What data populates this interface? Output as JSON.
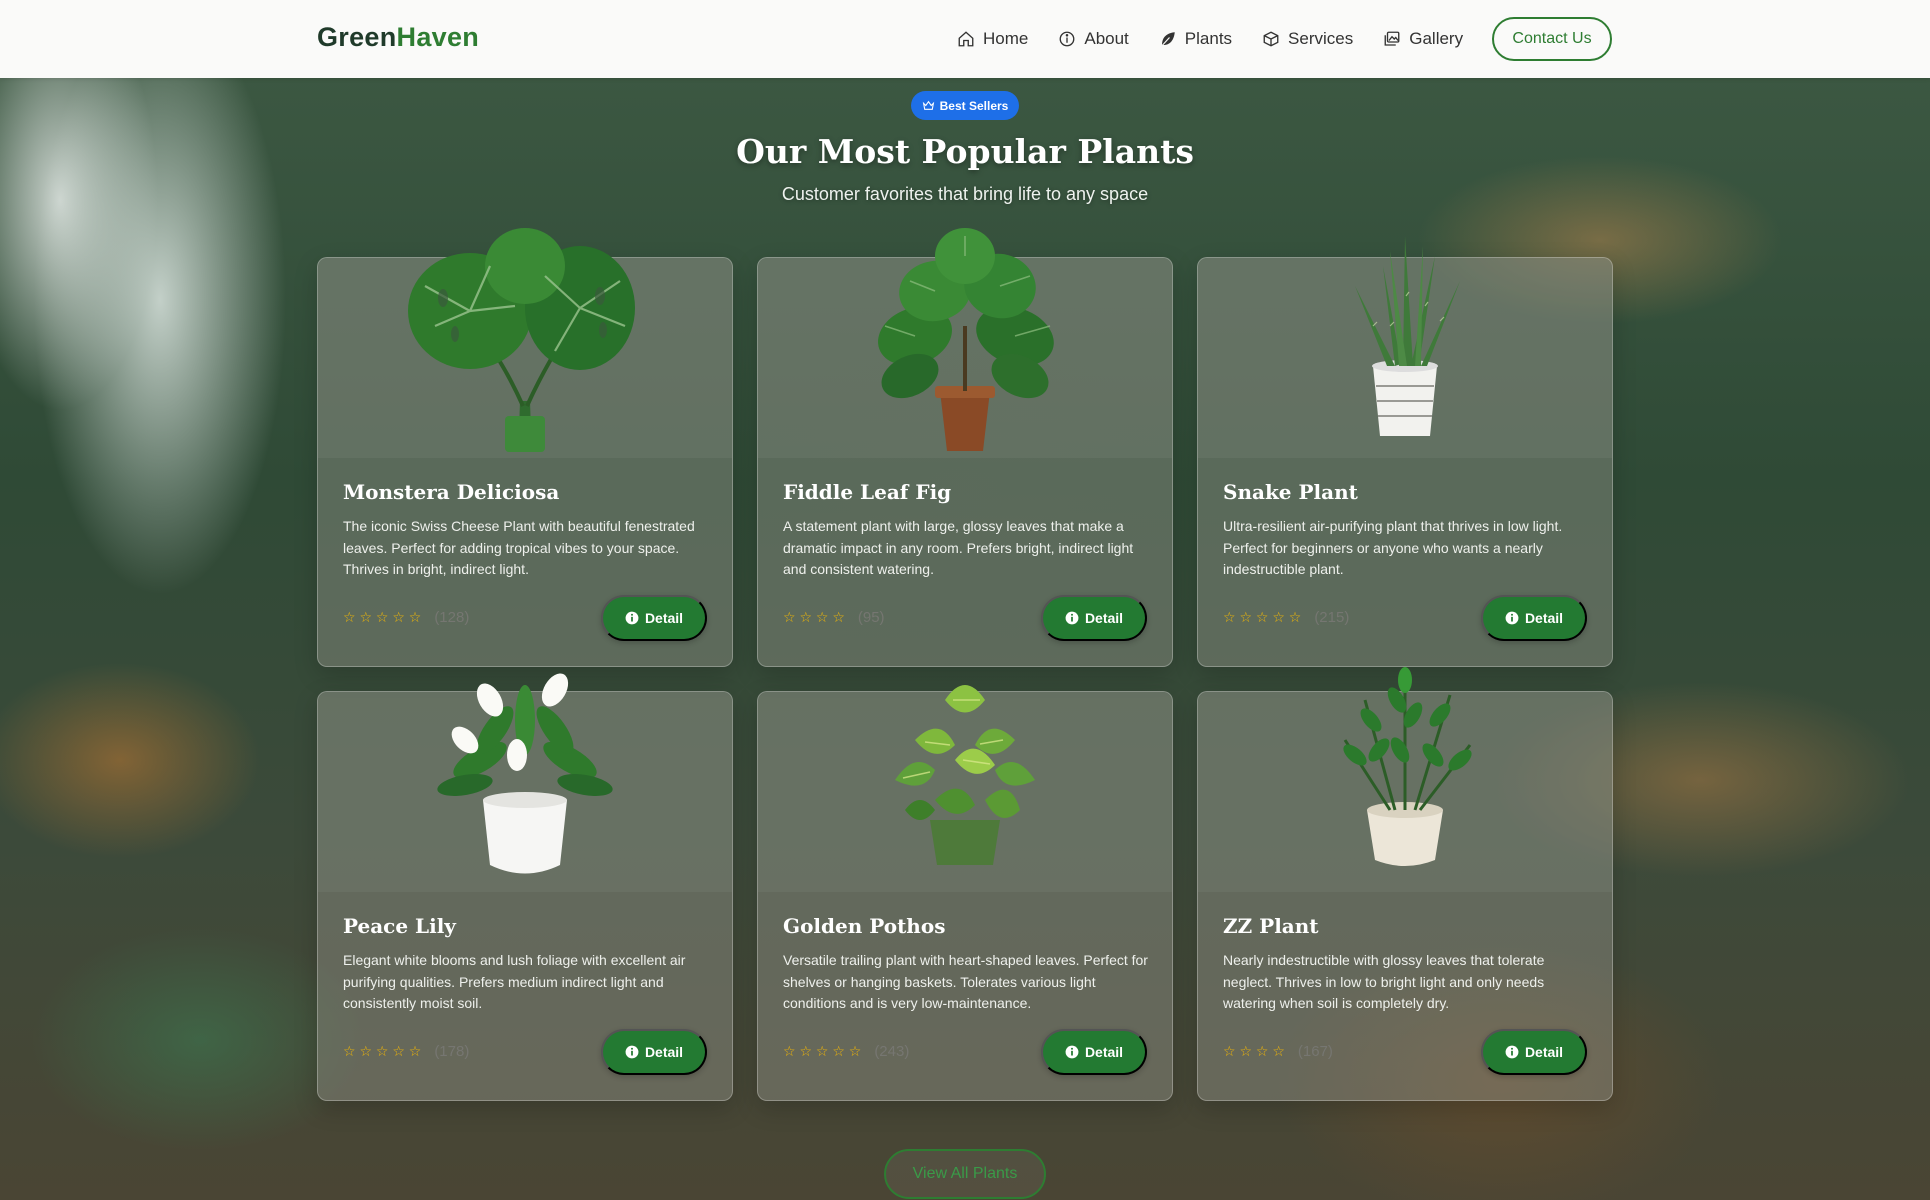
{
  "brand": {
    "part1": "Green",
    "part2": "Haven"
  },
  "nav": {
    "items": [
      {
        "label": "Home",
        "icon": "home-icon"
      },
      {
        "label": "About",
        "icon": "info-icon"
      },
      {
        "label": "Plants",
        "icon": "leaf-icon"
      },
      {
        "label": "Services",
        "icon": "box-icon"
      },
      {
        "label": "Gallery",
        "icon": "gallery-icon"
      }
    ],
    "contact_label": "Contact Us"
  },
  "section": {
    "badge": "Best Sellers",
    "badge_icon": "crown-icon",
    "title": "Our Most Popular Plants",
    "subtitle": "Customer favorites that bring life to any space"
  },
  "cards": [
    {
      "name": "Monstera Deliciosa",
      "description": "The iconic Swiss Cheese Plant with beautiful fenestrated leaves. Perfect for adding tropical vibes to your space. Thrives in bright, indirect light.",
      "rating": 5,
      "stars": "☆ ☆ ☆ ☆ ☆",
      "reviews": "(128)",
      "button": "Detail",
      "image": "monstera-image"
    },
    {
      "name": "Fiddle Leaf Fig",
      "description": "A statement plant with large, glossy leaves that make a dramatic impact in any room. Prefers bright, indirect light and consistent watering.",
      "rating": 4,
      "stars": "☆ ☆ ☆ ☆",
      "reviews": "(95)",
      "button": "Detail",
      "image": "fiddle-leaf-fig-image"
    },
    {
      "name": "Snake Plant",
      "description": "Ultra-resilient air-purifying plant that thrives in low light. Perfect for beginners or anyone who wants a nearly indestructible plant.",
      "rating": 5,
      "stars": "☆ ☆ ☆ ☆ ☆",
      "reviews": "(215)",
      "button": "Detail",
      "image": "snake-plant-image"
    },
    {
      "name": "Peace Lily",
      "description": "Elegant white blooms and lush foliage with excellent air purifying qualities. Prefers medium indirect light and consistently moist soil.",
      "rating": 5,
      "stars": "☆ ☆ ☆ ☆ ☆",
      "reviews": "(178)",
      "button": "Detail",
      "image": "peace-lily-image"
    },
    {
      "name": "Golden Pothos",
      "description": "Versatile trailing plant with heart-shaped leaves. Perfect for shelves or hanging baskets. Tolerates various light conditions and is very low-maintenance.",
      "rating": 5,
      "stars": "☆ ☆ ☆ ☆ ☆",
      "reviews": "(243)",
      "button": "Detail",
      "image": "golden-pothos-image"
    },
    {
      "name": "ZZ Plant",
      "description": "Nearly indestructible with glossy leaves that tolerate neglect. Thrives in low to bright light and only needs watering when soil is completely dry.",
      "rating": 4,
      "stars": "☆ ☆ ☆ ☆",
      "reviews": "(167)",
      "button": "Detail",
      "image": "zz-plant-image"
    }
  ],
  "view_all_label": "View All Plants",
  "colors": {
    "brand_dark": "#1f3a2a",
    "brand_green": "#2e7d32",
    "badge_blue": "#1e6fe8",
    "star": "#f2b705"
  }
}
